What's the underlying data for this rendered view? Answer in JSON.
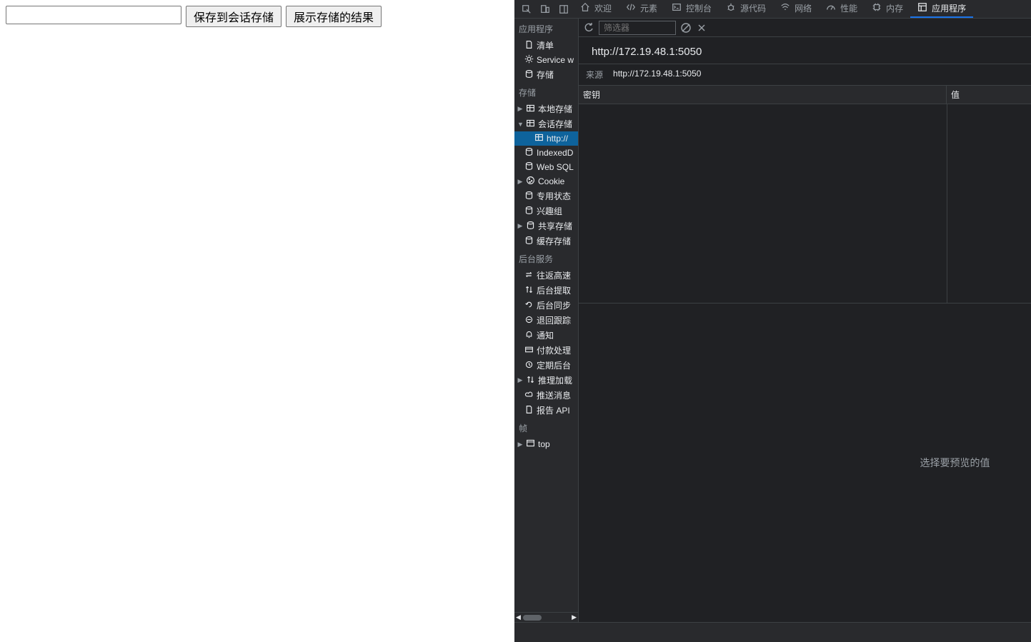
{
  "page": {
    "save_button": "保存到会话存储",
    "show_button": "展示存储的结果"
  },
  "tabs": {
    "welcome": "欢迎",
    "elements": "元素",
    "console": "控制台",
    "sources": "源代码",
    "network": "网络",
    "performance": "性能",
    "memory": "内存",
    "application": "应用程序"
  },
  "filter": {
    "placeholder": "筛选器"
  },
  "sidebar": {
    "section_app": "应用程序",
    "app": {
      "manifest": "清单",
      "sw": "Service w",
      "storage": "存储"
    },
    "section_storage": "存储",
    "storage": {
      "local": "本地存储",
      "session": "会话存储",
      "session_url": "http://",
      "indexeddb": "IndexedD",
      "websql": "Web SQL",
      "cookie": "Cookie",
      "private": "专用状态",
      "interest": "兴趣组",
      "shared": "共享存储",
      "cache": "缓存存储"
    },
    "section_bg": "后台服务",
    "bg": {
      "bfcache": "往返高速",
      "bgfetch": "后台提取",
      "bgsync": "后台同步",
      "bounce": "退回跟踪",
      "notif": "通知",
      "payment": "付款处理",
      "periodic": "定期后台",
      "speculative": "推理加载",
      "push": "推送消息",
      "report": "报告 API"
    },
    "section_frames": "帧",
    "frames": {
      "top": "top"
    }
  },
  "main": {
    "title_url": "http://172.19.48.1:5050",
    "origin_label": "来源",
    "origin_value": "http://172.19.48.1:5050",
    "col_key": "密钥",
    "col_value": "值",
    "preview_placeholder": "选择要预览的值"
  }
}
